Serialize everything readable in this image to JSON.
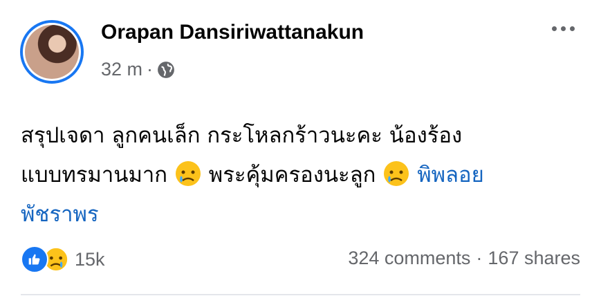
{
  "post": {
    "author": "Orapan Dansiriwattanakun",
    "time": "32 m",
    "separator": "·",
    "text_line1": "สรุปเจดา ลูกคนเล็ก กระโหลกร้าวนะคะ น้องร้อง",
    "text_line2": "แบบทรมานมาก",
    "text_mid": "พระคุ้มครองนะลูก",
    "tag_part1": "พิพลอย",
    "tag_part2": "พัชราพร",
    "privacy_icon": "globe-icon"
  },
  "reactions": {
    "types": [
      "like",
      "sad"
    ],
    "count": "15k"
  },
  "stats": {
    "comments": "324 comments",
    "dot": "·",
    "shares": "167 shares"
  },
  "colors": {
    "accent": "#1877f2",
    "secondary_text": "#65676b",
    "tag": "#1565c0"
  }
}
